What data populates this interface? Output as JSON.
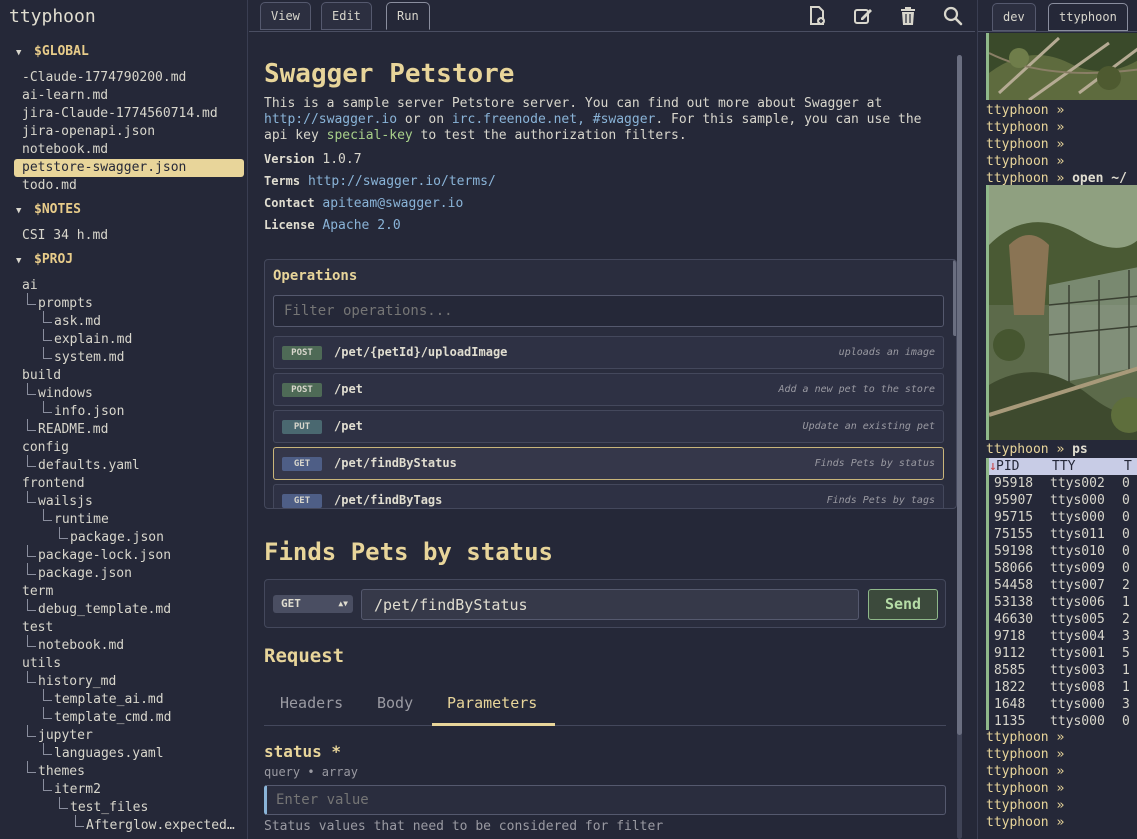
{
  "app": {
    "title": "ttyphoon"
  },
  "sidebar": {
    "sections": [
      {
        "name": "$GLOBAL",
        "items": [
          "-Claude-1774790200.md",
          "ai-learn.md",
          "jira-Claude-1774560714.md",
          "jira-openapi.json",
          "notebook.md",
          "petstore-swagger.json",
          "todo.md"
        ],
        "selected": "petstore-swagger.json"
      },
      {
        "name": "$NOTES",
        "items": [
          "CSI 34 h.md"
        ]
      },
      {
        "name": "$PROJ",
        "items": [
          "ai",
          "prompts",
          "ask.md",
          "explain.md",
          "system.md",
          "build",
          "windows",
          "info.json",
          "README.md",
          "config",
          "defaults.yaml",
          "frontend",
          "wailsjs",
          "runtime",
          "package.json",
          "package-lock.json",
          "package.json",
          "term",
          "debug_template.md",
          "test",
          "notebook.md",
          "utils",
          "history_md",
          "template_ai.md",
          "template_cmd.md",
          "jupyter",
          "languages.yaml",
          "themes",
          "iterm2",
          "test_files",
          "Afterglow.expected…"
        ]
      }
    ]
  },
  "main": {
    "tabs": [
      "View",
      "Edit",
      "Run"
    ],
    "active_tab": "Run",
    "toolbar_icons": [
      "new-file-icon",
      "edit-icon",
      "trash-icon",
      "search-icon"
    ]
  },
  "swagger": {
    "title": "Swagger Petstore",
    "desc_line1": "This is a sample server Petstore server. You can find out more about Swagger at",
    "desc_link1": "http://swagger.io",
    "desc_mid": " or on ",
    "desc_link2": "irc.freenode.net, #swagger",
    "desc_tail": ". For this sample, you can use the",
    "desc_line3_a": "api key ",
    "desc_key": "special-key",
    "desc_line3_b": " to test the authorization filters.",
    "version_label": "Version",
    "version": "1.0.7",
    "terms_label": "Terms",
    "terms": "http://swagger.io/terms/",
    "contact_label": "Contact",
    "contact": "apiteam@swagger.io",
    "license_label": "License",
    "license": "Apache 2.0"
  },
  "operations": {
    "title": "Operations",
    "filter_placeholder": "Filter operations...",
    "items": [
      {
        "method": "POST",
        "path": "/pet/{petId}/uploadImage",
        "summary": "uploads an image"
      },
      {
        "method": "POST",
        "path": "/pet",
        "summary": "Add a new pet to the store"
      },
      {
        "method": "PUT",
        "path": "/pet",
        "summary": "Update an existing pet"
      },
      {
        "method": "GET",
        "path": "/pet/findByStatus",
        "summary": "Finds Pets by status"
      },
      {
        "method": "GET",
        "path": "/pet/findByTags",
        "summary": "Finds Pets by tags"
      }
    ],
    "selected_index": 3
  },
  "operation": {
    "title": "Finds Pets by status",
    "method": "GET",
    "url": "/pet/findByStatus",
    "send_label": "Send",
    "request_title": "Request",
    "request_tabs": [
      "Headers",
      "Body",
      "Parameters"
    ],
    "active_request_tab": "Parameters",
    "param_name": "status *",
    "param_type": "query • array",
    "param_placeholder": "Enter value",
    "param_desc": "Status values that need to be considered for filter"
  },
  "terminal": {
    "tabs": [
      "dev",
      "ttyphoon"
    ],
    "active_tab": "ttyphoon",
    "prompt": "ttyphoon »",
    "lines_top": [
      "",
      "",
      "",
      ""
    ],
    "open_cmd": "open ~/",
    "ps_cmd": "ps",
    "ps_headers": [
      "PID",
      "TTY",
      "T"
    ],
    "ps_rows": [
      [
        "95918",
        "ttys002",
        "0"
      ],
      [
        "95907",
        "ttys000",
        "0"
      ],
      [
        "95715",
        "ttys000",
        "0"
      ],
      [
        "75155",
        "ttys011",
        "0"
      ],
      [
        "59198",
        "ttys010",
        "0"
      ],
      [
        "58066",
        "ttys009",
        "0"
      ],
      [
        "54458",
        "ttys007",
        "2"
      ],
      [
        "53138",
        "ttys006",
        "1"
      ],
      [
        "46630",
        "ttys005",
        "2"
      ],
      [
        "9718",
        "ttys004",
        "3"
      ],
      [
        "9112",
        "ttys001",
        "5"
      ],
      [
        "8585",
        "ttys003",
        "1"
      ],
      [
        "1822",
        "ttys008",
        "1"
      ],
      [
        "1648",
        "ttys000",
        "3"
      ],
      [
        "1135",
        "ttys000",
        "0"
      ]
    ],
    "trailing_prompts": 6
  }
}
